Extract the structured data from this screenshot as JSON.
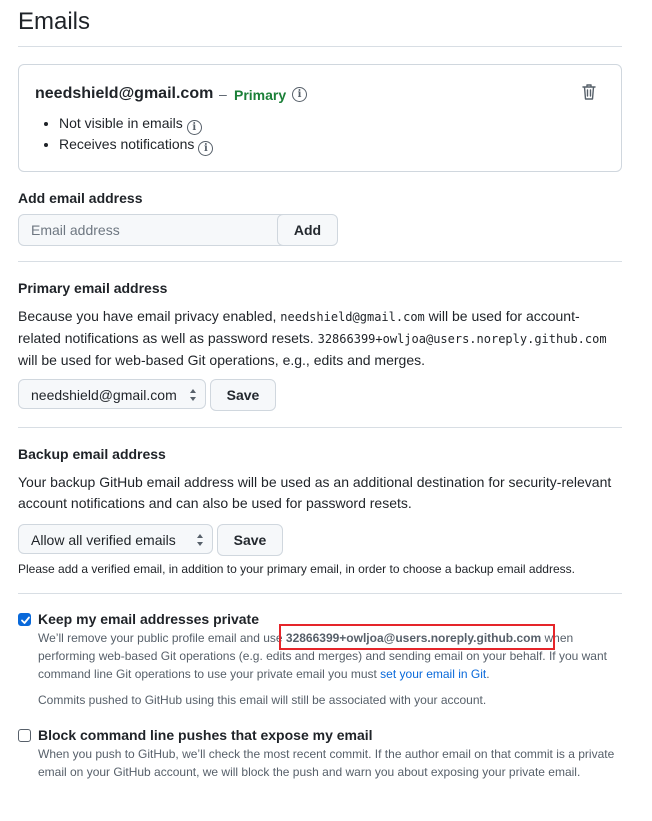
{
  "page_title": "Emails",
  "primary_box": {
    "email": "needshield@gmail.com",
    "dash": "–",
    "primary_label": "Primary",
    "bullets": [
      "Not visible in emails",
      "Receives notifications"
    ],
    "icons": {
      "info": "info-icon",
      "delete": "trash-icon"
    }
  },
  "add_email": {
    "heading": "Add email address",
    "placeholder": "Email address",
    "button": "Add"
  },
  "primary_email": {
    "heading": "Primary email address",
    "text_1": "Because you have email privacy enabled,",
    "email_code": "needshield@gmail.com",
    "text_2": "will be used for account-related notifications as well as password resets.",
    "noreply_code": "32866399+owljoa@users.noreply.github.com",
    "text_3": "will be used for web-based Git operations, e.g., edits and merges.",
    "select_value": "needshield@gmail.com",
    "save": "Save"
  },
  "backup_email": {
    "heading": "Backup email address",
    "text": "Your backup GitHub email address will be used as an additional destination for security-relevant account notifications and can also be used for password resets.",
    "select_value": "Allow all verified emails",
    "save": "Save",
    "note": "Please add a verified email, in addition to your primary email, in order to choose a backup email address."
  },
  "keep_private": {
    "checked": true,
    "label": "Keep my email addresses private",
    "text_1": "We’ll remove your public profile email and use",
    "noreply_email": "32866399+owljoa@users.noreply.github.com",
    "text_2": "when performing web-based Git operations (e.g. edits and merges) and sending email on your behalf. If you want command line Git operations to use your private email you must",
    "link": "set your email in Git",
    "text_3": ".",
    "commits_note": "Commits pushed to GitHub using this email will still be associated with your account."
  },
  "block_push": {
    "checked": false,
    "label": "Block command line pushes that expose my email",
    "text": "When you push to GitHub, we’ll check the most recent commit. If the author email on that commit is a private email on your GitHub account, we will block the push and warn you about exposing your private email."
  },
  "colors": {
    "primary_green": "#1a7f37",
    "link_blue": "#0969da",
    "highlight_red": "#e5252a",
    "checkbox_blue": "#0969da"
  }
}
